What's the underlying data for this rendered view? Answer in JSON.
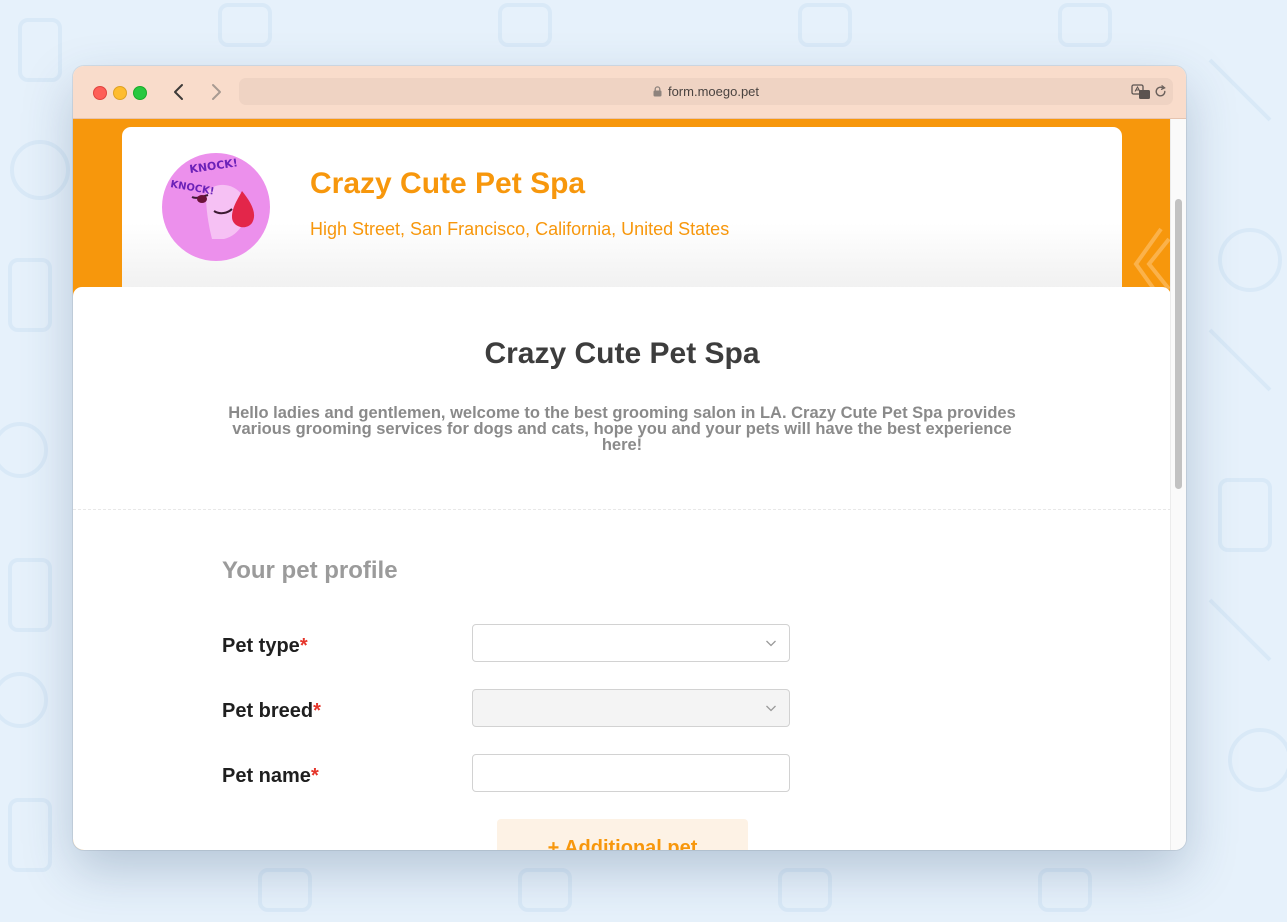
{
  "browser": {
    "url": "form.moego.pet",
    "icons": [
      "back-icon",
      "forward-icon",
      "lock-icon",
      "translate-icon",
      "reload-icon"
    ]
  },
  "business": {
    "name": "Crazy Cute Pet Spa",
    "address": "High Street, San Francisco, California, United States",
    "logo_text_1": "KNOCK!",
    "logo_text_2": "KNOCK!"
  },
  "form": {
    "title": "Crazy Cute Pet Spa",
    "description": "Hello ladies and gentlemen, welcome to the best grooming salon in LA. Crazy Cute Pet Spa provides various grooming services for dogs and cats, hope you and your pets will have the best experience here!",
    "section_title": "Your pet profile",
    "fields": [
      {
        "label": "Pet type",
        "required_mark": "*",
        "kind": "select",
        "value": "",
        "disabled": false
      },
      {
        "label": "Pet breed",
        "required_mark": "*",
        "kind": "select",
        "value": "",
        "disabled": true
      },
      {
        "label": "Pet name",
        "required_mark": "*",
        "kind": "text",
        "value": "",
        "disabled": false
      }
    ],
    "add_pet_label": "+ Additional pet"
  },
  "colors": {
    "brand_orange": "#f7970c",
    "required_red": "#e5352a",
    "titlebar": "#f9dccb",
    "page_background": "#e6f1fb"
  }
}
